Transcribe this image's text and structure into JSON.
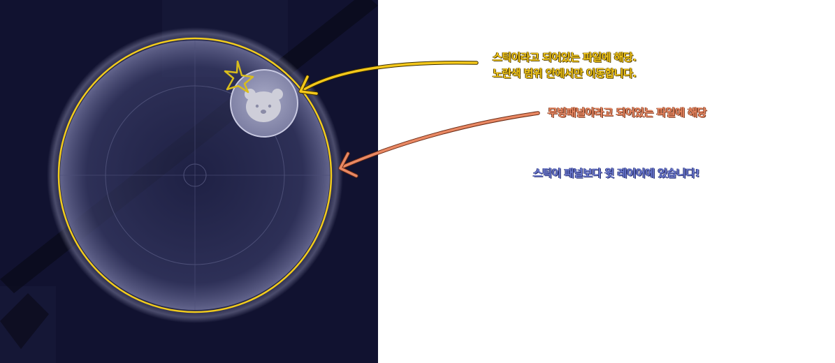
{
  "annotations": {
    "stick_line1": "스틱이라고 되어있는 파일에 해당.",
    "stick_line2": "노란색 범위 안에서만 이동합니다.",
    "panel_note": "무빙패널이라고 되어있는 파일에 해당",
    "layer_note": "스틱이 패널보다 윗 레이어에 있습니다!"
  },
  "icons": {
    "stick_knob": "bear-face-icon",
    "star_mark": "star-doodle-icon"
  },
  "colors": {
    "background_dark": "#111230",
    "range_ring": "#f2cc1c",
    "stick_annotation": "#f4c81a",
    "panel_annotation": "#e98863",
    "layer_annotation": "#6b79cf"
  }
}
